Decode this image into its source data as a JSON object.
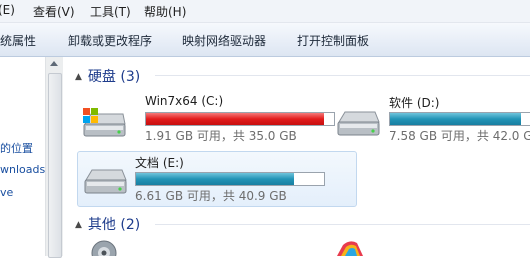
{
  "menu": [
    "(E)",
    "查看(V)",
    "工具(T)",
    "帮助(H)"
  ],
  "toolbar": [
    "统属性",
    "卸载或更改程序",
    "映射网络驱动器",
    "打开控制面板"
  ],
  "nav": [
    "的位置",
    "wnloads",
    "ve"
  ],
  "groups": {
    "hard_disks": "硬盘 (3)",
    "other": "其他 (2)"
  },
  "drives": [
    {
      "name": "Win7x64 (C:)",
      "free": "1.91 GB 可用，共 35.0 GB",
      "used_fraction": 0.945,
      "status_color": "#e21c1c"
    },
    {
      "name": "软件 (D:)",
      "free": "7.58 GB 可用，共 42.0 GB",
      "used_fraction": 0.82,
      "status_color": "#2394b6"
    },
    {
      "name": "文档 (E:)",
      "free": "6.61 GB 可用，共 40.9 GB",
      "used_fraction": 0.838,
      "status_color": "#2394b6"
    }
  ]
}
